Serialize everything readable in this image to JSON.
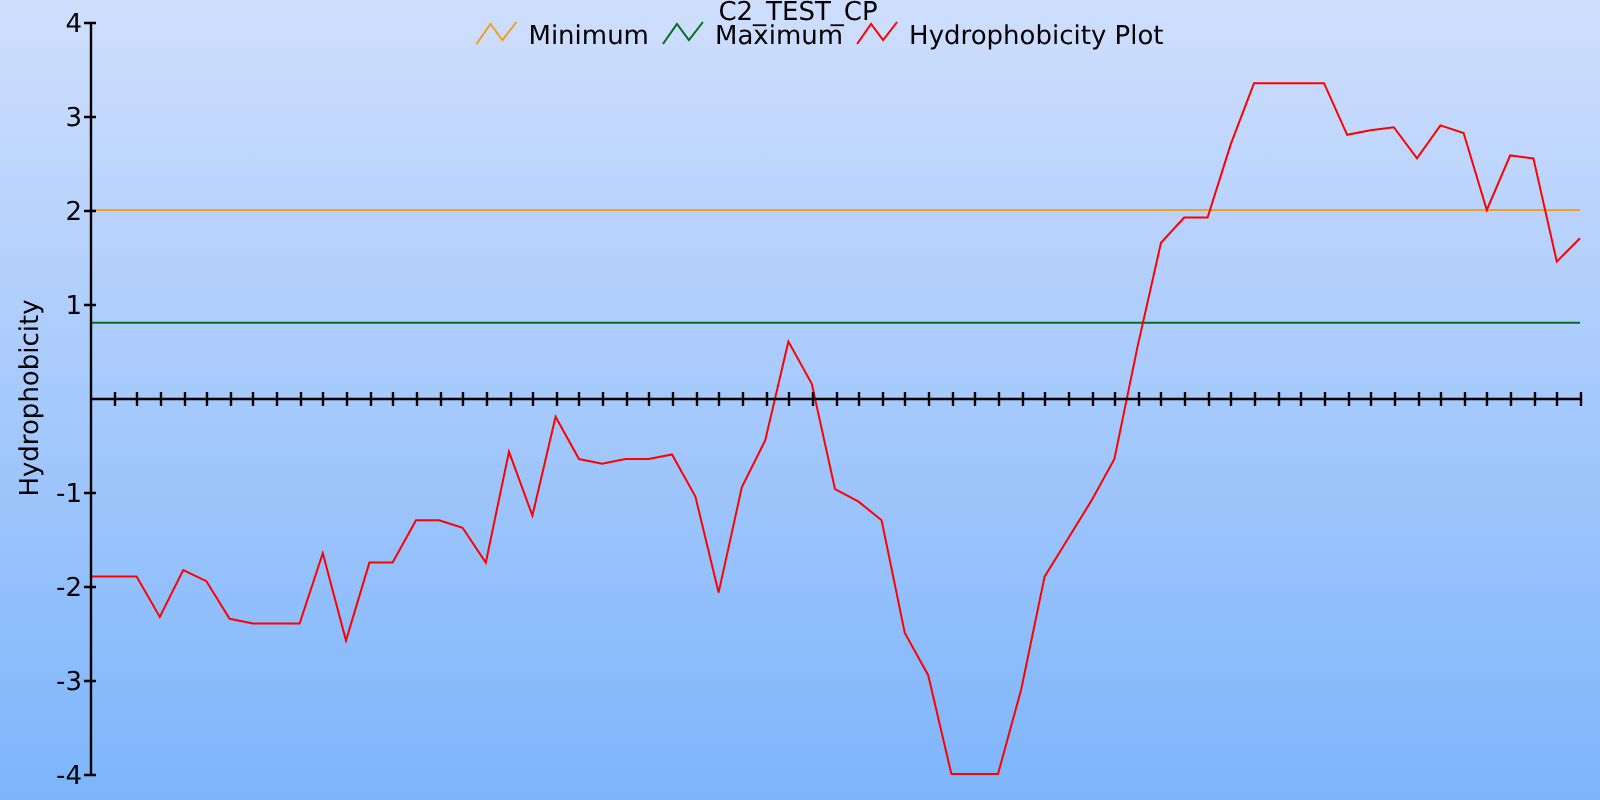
{
  "chart": {
    "chart_data": {
      "type": "line",
      "legend": "top",
      "title": "C2_TEST_CP",
      "ylabel": "Hydrophobicity",
      "ylim": [
        -4,
        4
      ],
      "yticks": [
        -4,
        -3,
        -2,
        -1,
        1,
        2,
        3,
        4
      ],
      "series": [
        {
          "name": "Minimum",
          "color": "#f0a020",
          "values": [
            2,
            2,
            2,
            2,
            2,
            2,
            2,
            2,
            2,
            2,
            2,
            2,
            2,
            2,
            2,
            2,
            2,
            2,
            2,
            2,
            2,
            2,
            2,
            2,
            2,
            2,
            2,
            2,
            2,
            2,
            2,
            2,
            2,
            2,
            2,
            2,
            2,
            2,
            2,
            2,
            2,
            2,
            2,
            2,
            2,
            2,
            2,
            2,
            2,
            2,
            2,
            2,
            2,
            2,
            2,
            2,
            2,
            2,
            2,
            2,
            2,
            2,
            2,
            2,
            2
          ]
        },
        {
          "name": "Maximum",
          "color": "#007020",
          "values": [
            0.8,
            0.8,
            0.8,
            0.8,
            0.8,
            0.8,
            0.8,
            0.8,
            0.8,
            0.8,
            0.8,
            0.8,
            0.8,
            0.8,
            0.8,
            0.8,
            0.8,
            0.8,
            0.8,
            0.8,
            0.8,
            0.8,
            0.8,
            0.8,
            0.8,
            0.8,
            0.8,
            0.8,
            0.8,
            0.8,
            0.8,
            0.8,
            0.8,
            0.8,
            0.8,
            0.8,
            0.8,
            0.8,
            0.8,
            0.8,
            0.8,
            0.8,
            0.8,
            0.8,
            0.8,
            0.8,
            0.8,
            0.8,
            0.8,
            0.8,
            0.8,
            0.8,
            0.8,
            0.8,
            0.8,
            0.8,
            0.8,
            0.8,
            0.8,
            0.8,
            0.8,
            0.8,
            0.8,
            0.8,
            0.8
          ]
        },
        {
          "name": "Hydrophobicity Plot",
          "color": "#ff0000",
          "values": [
            -1.9,
            -1.9,
            -1.9,
            -2.33,
            -1.83,
            -1.95,
            -2.35,
            -2.4,
            -2.4,
            -2.4,
            -1.65,
            -2.58,
            -1.75,
            -1.75,
            -1.3,
            -1.3,
            -1.38,
            -1.75,
            -0.57,
            -1.25,
            -0.2,
            -0.65,
            -0.7,
            -0.65,
            -0.65,
            -0.6,
            -1.05,
            -2.07,
            -0.95,
            -0.45,
            0.6,
            0.15,
            -0.97,
            -1.1,
            -1.3,
            -2.5,
            -2.95,
            -4,
            -4,
            -4,
            -3.1,
            -1.9,
            -1.5,
            -1.1,
            -0.65,
            0.55,
            1.65,
            1.92,
            1.92,
            2.7,
            3.35,
            3.35,
            3.35,
            3.35,
            2.8,
            2.85,
            2.88,
            2.55,
            2.9,
            2.82,
            2,
            2.58,
            2.55,
            1.45,
            1.7
          ]
        }
      ]
    }
  }
}
